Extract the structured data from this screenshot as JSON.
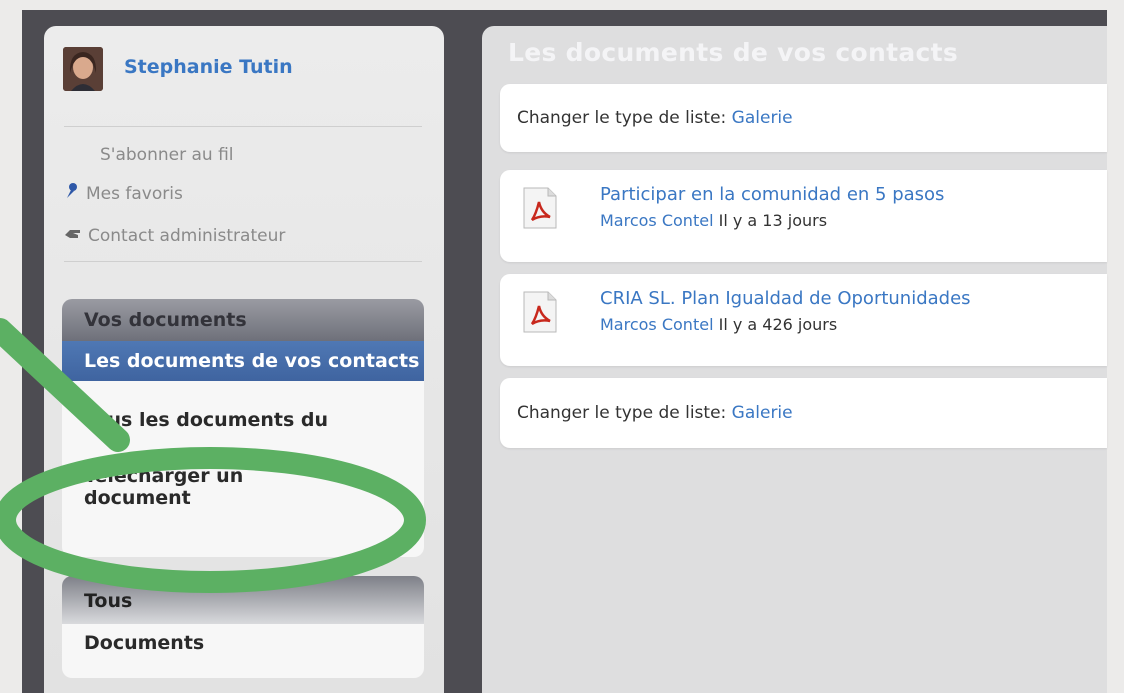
{
  "user": {
    "name": "Stephanie Tutin"
  },
  "meta_links": [
    {
      "label": "S'abonner au fil",
      "icon": ""
    },
    {
      "label": "Mes favoris",
      "icon": "pin-icon"
    },
    {
      "label": "Contact administrateur",
      "icon": "hand-icon"
    }
  ],
  "nav": {
    "section1": {
      "header": "Vos documents",
      "items": [
        "Les documents de vos contacts",
        "Tous les documents du",
        "Télécharger un document"
      ]
    },
    "section2": {
      "header": "Tous",
      "items": [
        "Documents"
      ]
    }
  },
  "main": {
    "title": "Les documents de vos contacts",
    "change_label": "Changer le type de liste:",
    "change_link": "Galerie",
    "documents": [
      {
        "title": "Participar en la comunidad en 5 pasos",
        "author": "Marcos Contel",
        "age": "Il y a 13 jours",
        "icon": "pdf-icon"
      },
      {
        "title": "CRIA SL. Plan Igualdad de Oportunidades",
        "author": "Marcos Contel",
        "age": "Il y a 426 jours",
        "icon": "pdf-icon"
      }
    ]
  },
  "colors": {
    "accent": "#3a77c3",
    "annotation": "#5cb063",
    "frame": "#4d4c52"
  }
}
